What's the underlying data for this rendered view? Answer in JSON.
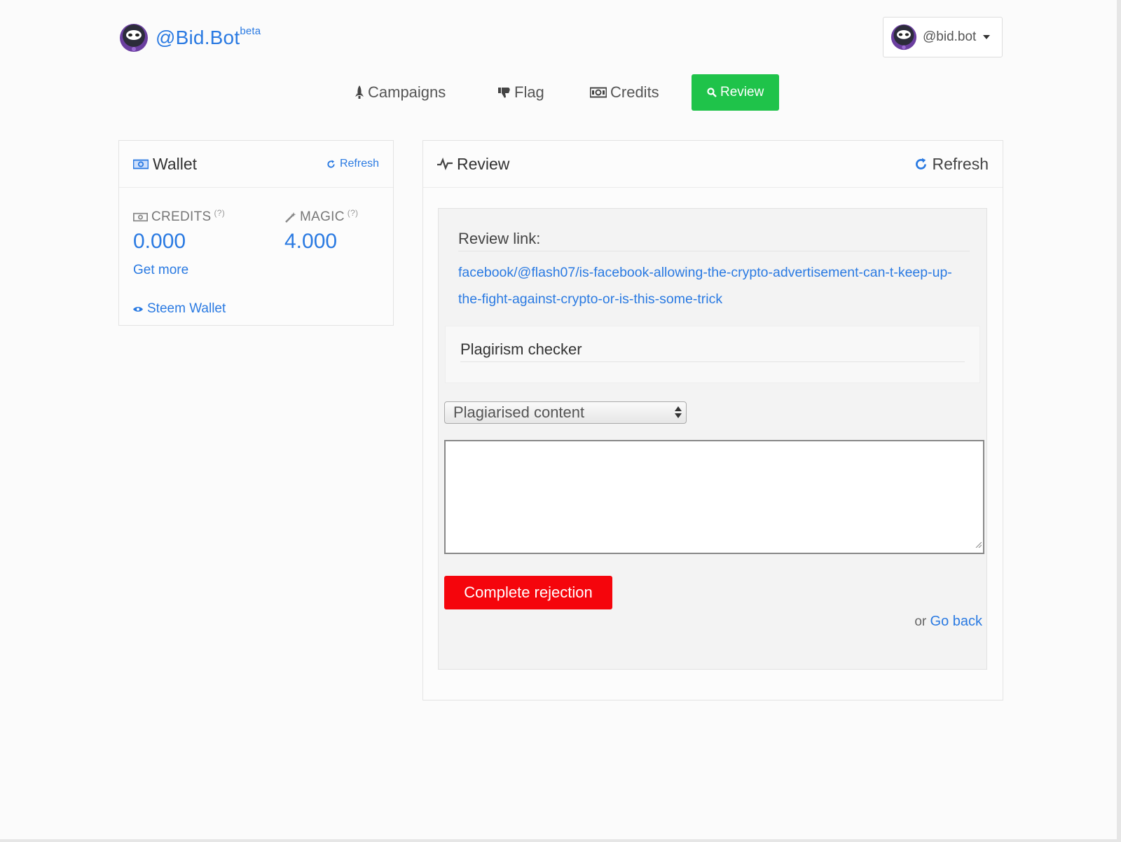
{
  "brand": {
    "name": "@Bid.Bot",
    "badge": "beta"
  },
  "user": {
    "handle": "@bid.bot"
  },
  "nav": {
    "campaigns": "Campaigns",
    "flag": "Flag",
    "credits": "Credits",
    "review": "Review"
  },
  "wallet": {
    "title": "Wallet",
    "refresh": "Refresh",
    "credits_label": "CREDITS",
    "credits_help": "(?)",
    "credits_value": "0.000",
    "magic_label": "MAGIC",
    "magic_help": "(?)",
    "magic_value": "4.000",
    "get_more": "Get more",
    "steem_wallet": "Steem Wallet"
  },
  "review": {
    "title": "Review",
    "refresh": "Refresh",
    "link_label": "Review link:",
    "link_text": "facebook/@flash07/is-facebook-allowing-the-crypto-advertisement-can-t-keep-up-the-fight-against-crypto-or-is-this-some-trick",
    "plagiarism_label": "Plagirism checker",
    "reason_selected": "Plagiarised content",
    "comment_value": "",
    "reject_button": "Complete rejection",
    "or_text": "or",
    "go_back": "Go back"
  },
  "colors": {
    "accent": "#2a7ae2",
    "nav_active": "#1fc34a",
    "reject": "#f5050c"
  },
  "icons": [
    "bot-avatar-icon",
    "caret-down-icon",
    "rocket-icon",
    "thumbs-down-icon",
    "money-icon",
    "search-icon",
    "refresh-icon",
    "pulse-icon",
    "magic-wand-icon",
    "eye-icon",
    "resize-grip-icon"
  ]
}
